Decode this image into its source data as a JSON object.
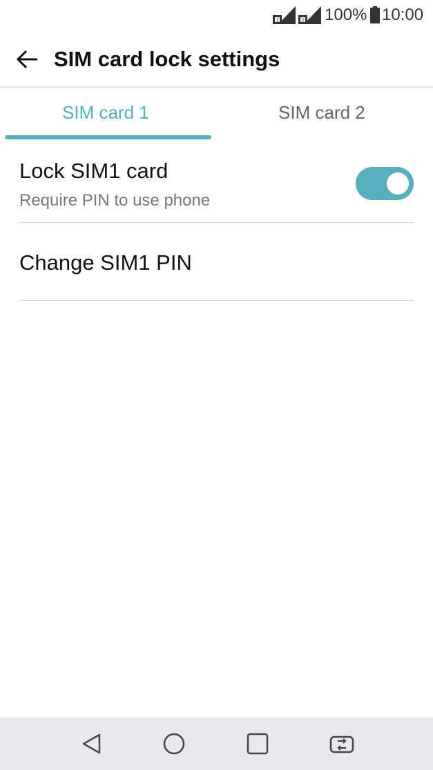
{
  "status_bar": {
    "battery_percent": "100%",
    "time": "10:00",
    "sim1_icon": "sim1-signal-icon",
    "sim2_icon": "sim2-signal-icon",
    "battery_icon": "battery-icon"
  },
  "app_bar": {
    "back_icon": "back-arrow-icon",
    "title": "SIM card lock settings"
  },
  "tabs": [
    {
      "label": "SIM card 1",
      "selected": true
    },
    {
      "label": "SIM card 2",
      "selected": false
    }
  ],
  "settings": {
    "lock_sim": {
      "title": "Lock SIM1 card",
      "subtitle": "Require PIN to use phone",
      "toggle_on": true
    },
    "change_pin": {
      "title": "Change SIM1 PIN"
    }
  },
  "nav_bar": {
    "buttons": [
      "back-triangle-icon",
      "home-circle-icon",
      "recents-square-icon",
      "dual-window-icon"
    ]
  },
  "colors": {
    "accent": "#59aebb",
    "nav_bg": "#e9e9ec"
  }
}
